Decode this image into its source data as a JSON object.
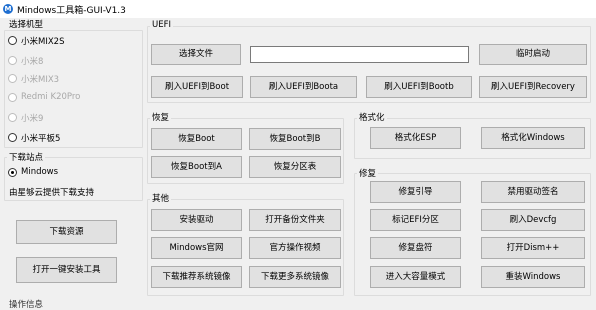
{
  "window": {
    "title": "Mindows工具箱-GUI-V1.3",
    "icon_letter": "M"
  },
  "model_group": {
    "title": "选择机型",
    "options": [
      {
        "label": "小米MIX2S",
        "enabled": true,
        "checked": false
      },
      {
        "label": "小米8",
        "enabled": false,
        "checked": false
      },
      {
        "label": "小米MIX3",
        "enabled": false,
        "checked": false
      },
      {
        "label": "Redmi K20Pro",
        "enabled": false,
        "checked": false
      },
      {
        "label": "小米9",
        "enabled": false,
        "checked": false
      },
      {
        "label": "小米平板5",
        "enabled": true,
        "checked": false
      }
    ]
  },
  "download_group": {
    "title": "下载站点",
    "option": {
      "label": "Mindows",
      "checked": true
    },
    "note": "由星够云提供下载支持"
  },
  "left_buttons": {
    "download": "下载资源",
    "open_installer": "打开一键安装工具"
  },
  "bottom_clipped_text": "操作信息",
  "uefi": {
    "title": "UEFI",
    "select_file": "选择文件",
    "file_path": "",
    "temp_boot": "临时启动",
    "flash_boot": "刷入UEFI到Boot",
    "flash_boota": "刷入UEFI到Boota",
    "flash_bootb": "刷入UEFI到Bootb",
    "flash_recovery": "刷入UEFI到Recovery"
  },
  "restore": {
    "title": "恢复",
    "boot": "恢复Boot",
    "bootb": "恢复Boot到B",
    "boota": "恢复Boot到A",
    "partition": "恢复分区表"
  },
  "format": {
    "title": "格式化",
    "esp": "格式化ESP",
    "windows": "格式化Windows"
  },
  "other": {
    "title": "其他",
    "install_driver": "安装驱动",
    "open_backup": "打开备份文件夹",
    "website": "Mindows官网",
    "video": "官方操作视频",
    "recommended_image": "下载推荐系统镜像",
    "more_images": "下载更多系统镜像"
  },
  "repair": {
    "title": "修复",
    "boot_repair": "修复引导",
    "disable_sig": "禁用驱动签名",
    "mark_efi": "标记EFI分区",
    "flash_devcfg": "刷入Devcfg",
    "drive_letter": "修复盘符",
    "dism": "打开Dism++",
    "mass_storage": "进入大容量模式",
    "reboot_windows": "重装Windows"
  }
}
